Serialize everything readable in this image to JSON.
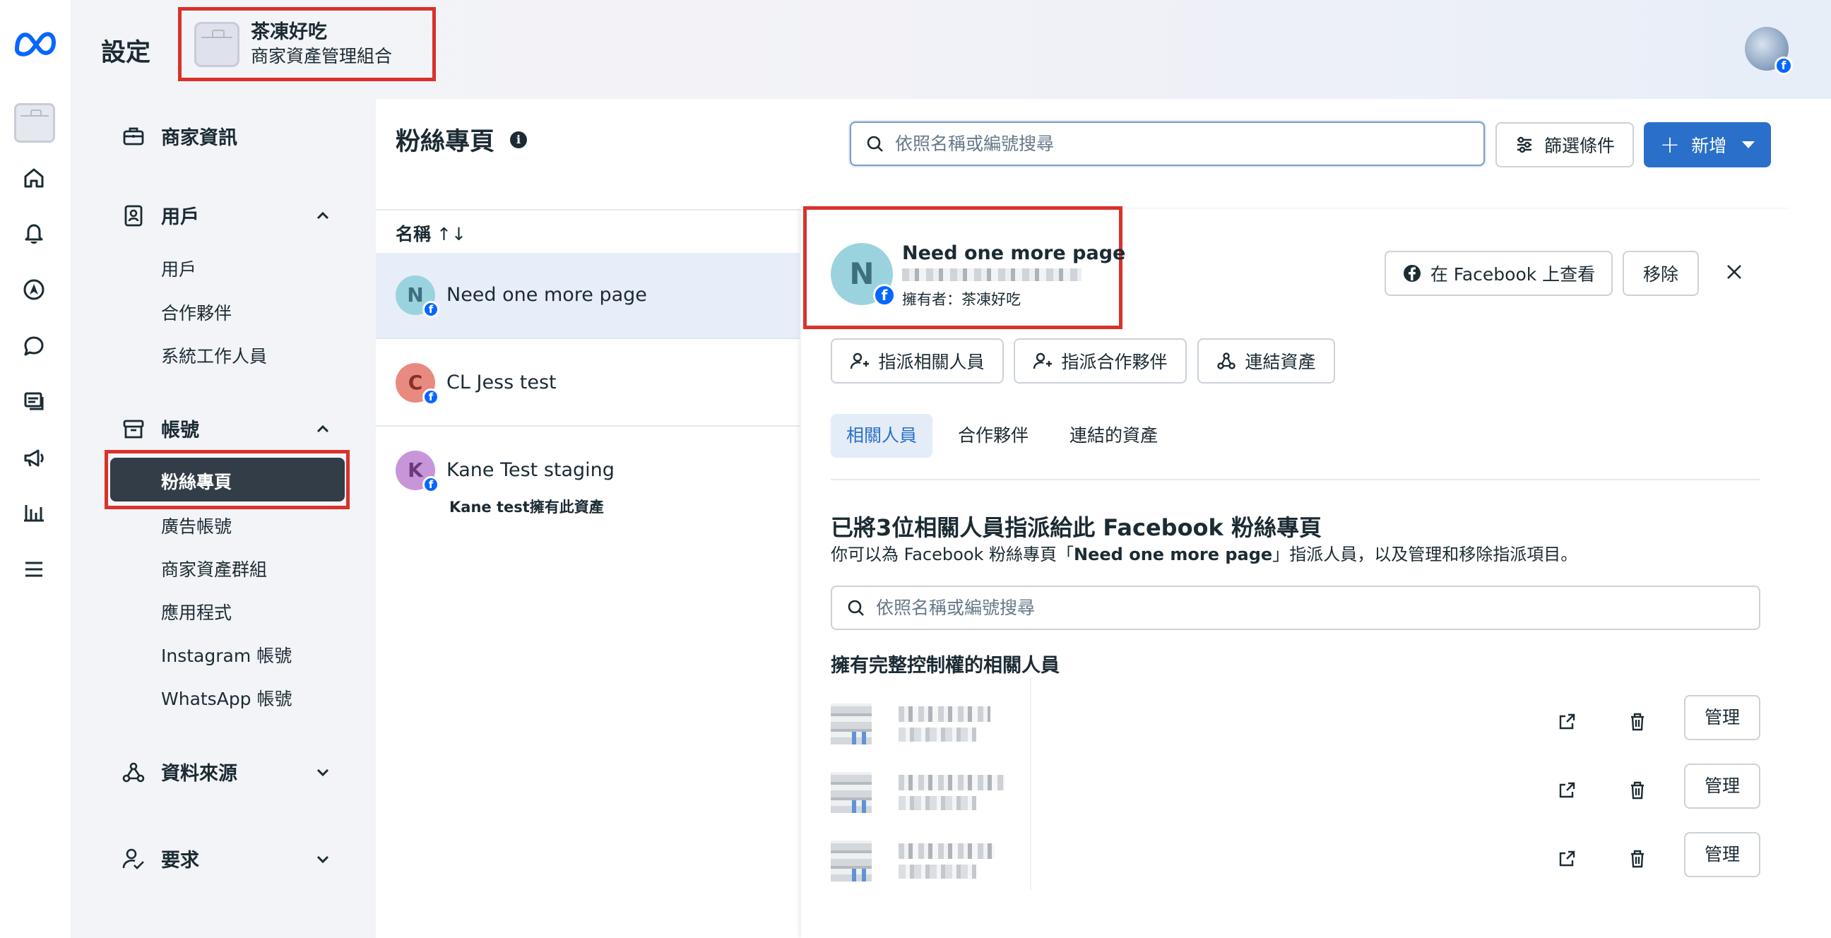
{
  "header": {
    "title": "設定",
    "account_name": "茶凍好吃",
    "account_type": "商家資產管理組合"
  },
  "sidebar": {
    "sections": [
      {
        "label": "商家資訊",
        "icon": "briefcase-icon"
      },
      {
        "label": "用戶",
        "icon": "user-badge-icon",
        "expanded": true,
        "items": [
          "用戶",
          "合作夥伴",
          "系統工作人員"
        ]
      },
      {
        "label": "帳號",
        "icon": "archive-box-icon",
        "expanded": true,
        "items": [
          "粉絲專頁",
          "廣告帳號",
          "商家資產群組",
          "應用程式",
          "Instagram 帳號",
          "WhatsApp 帳號"
        ]
      },
      {
        "label": "資料來源",
        "icon": "data-source-icon",
        "expanded": false
      },
      {
        "label": "要求",
        "icon": "user-check-icon",
        "expanded": false
      }
    ],
    "active_item": "粉絲專頁"
  },
  "main": {
    "title": "粉絲專頁",
    "search_placeholder": "依照名稱或編號搜尋",
    "filter_label": "篩選條件",
    "new_label": "新增",
    "list_header": "名稱",
    "sort_glyph": "↑↓",
    "pages": [
      {
        "initial": "N",
        "name": "Need one more page",
        "color": "#9ad3de",
        "text_color": "#3e6f7c",
        "note": ""
      },
      {
        "initial": "C",
        "name": "CL Jess test",
        "color": "#e98a80",
        "text_color": "#8a2f27",
        "note": ""
      },
      {
        "initial": "K",
        "name": "Kane Test staging",
        "color": "#c896d8",
        "text_color": "#6b3a7d",
        "note": "Kane test擁有此資產"
      }
    ]
  },
  "detail": {
    "initial": "N",
    "name": "Need one more page",
    "owner": "擁有者：茶凍好吃",
    "view_on_fb_label": "在 Facebook 上查看",
    "remove_label": "移除",
    "assign_people_label": "指派相關人員",
    "assign_partner_label": "指派合作夥伴",
    "connect_assets_label": "連結資產",
    "tabs": [
      "相關人員",
      "合作夥伴",
      "連結的資產"
    ],
    "active_tab": "相關人員",
    "assign_title": "已將3位相關人員指派給此 Facebook 粉絲專頁",
    "assign_desc_prefix": "你可以為 Facebook 粉絲專頁「",
    "assign_desc_page": "Need one more page",
    "assign_desc_suffix": "」指派人員，以及管理和移除指派項目。",
    "search_placeholder": "依照名稱或編號搜尋",
    "full_control_heading": "擁有完整控制權的相關人員",
    "manage_label": "管理",
    "people_count": 3
  },
  "colors": {
    "accent": "#2a6fc9",
    "highlight": "#d8322b",
    "active_nav": "#323d47",
    "facebook": "#0866ff"
  }
}
